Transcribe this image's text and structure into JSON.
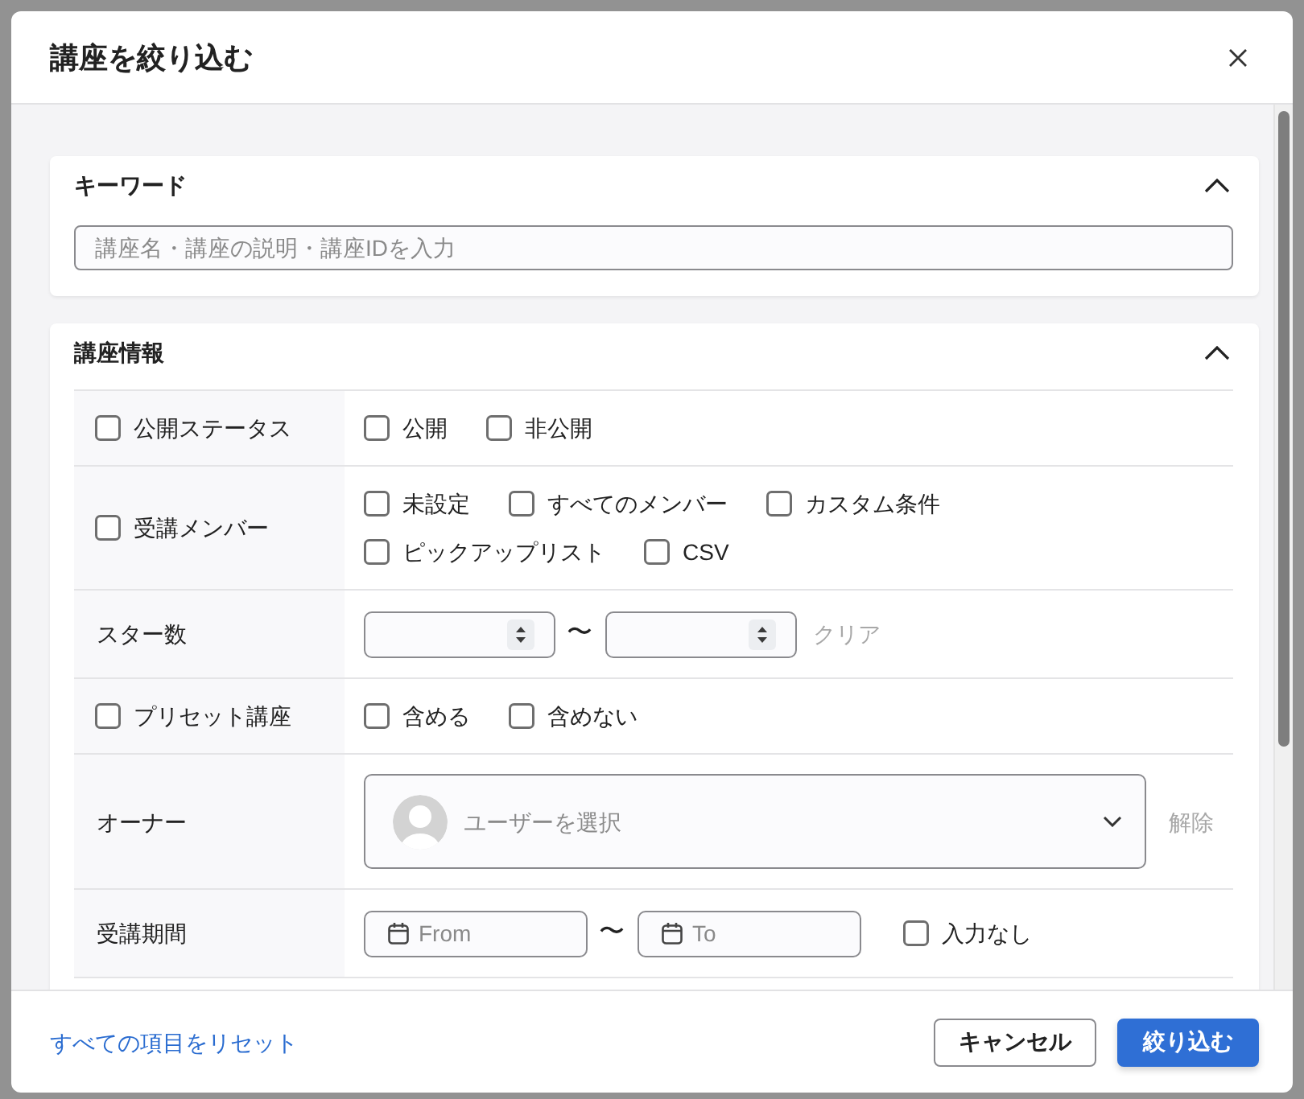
{
  "dialog": {
    "title": "講座を絞り込む"
  },
  "sections": [
    {
      "kind": "keyword",
      "title": "キーワード",
      "expanded": true,
      "field": {
        "placeholder": "講座名・講座の説明・講座IDを入力"
      }
    },
    {
      "kind": "table",
      "title": "講座情報",
      "expanded": true,
      "rows": [
        {
          "kind": "checks",
          "label": "公開ステータス",
          "checked": false,
          "options": [
            {
              "label": "公開",
              "checked": false
            },
            {
              "label": "非公開",
              "checked": false
            }
          ]
        },
        {
          "kind": "checks",
          "label": "受講メンバー",
          "checked": false,
          "options": [
            {
              "label": "未設定",
              "checked": false
            },
            {
              "label": "すべてのメンバー",
              "checked": false
            },
            {
              "label": "カスタム条件",
              "checked": false
            },
            {
              "label": "ピックアップリスト",
              "checked": false
            },
            {
              "label": "CSV",
              "checked": false
            }
          ]
        },
        {
          "kind": "range",
          "label": "スター数",
          "separator": "〜",
          "clear": "クリア"
        },
        {
          "kind": "checks",
          "label": "プリセット講座",
          "checked": false,
          "options": [
            {
              "label": "含める",
              "checked": false
            },
            {
              "label": "含めない",
              "checked": false
            }
          ]
        },
        {
          "kind": "user",
          "label": "オーナー",
          "placeholder": "ユーザーを選択",
          "clear": "解除"
        },
        {
          "kind": "dates",
          "label": "受講期間",
          "from": {
            "placeholder": "From"
          },
          "separator": "〜",
          "to": {
            "placeholder": "To"
          },
          "option": {
            "label": "入力なし",
            "checked": false
          }
        }
      ]
    }
  ],
  "footer": {
    "reset_link": "すべての項目をリセット",
    "buttons": [
      {
        "kind": "secondary",
        "label": "キャンセル"
      },
      {
        "kind": "primary",
        "label": "絞り込む"
      }
    ]
  }
}
